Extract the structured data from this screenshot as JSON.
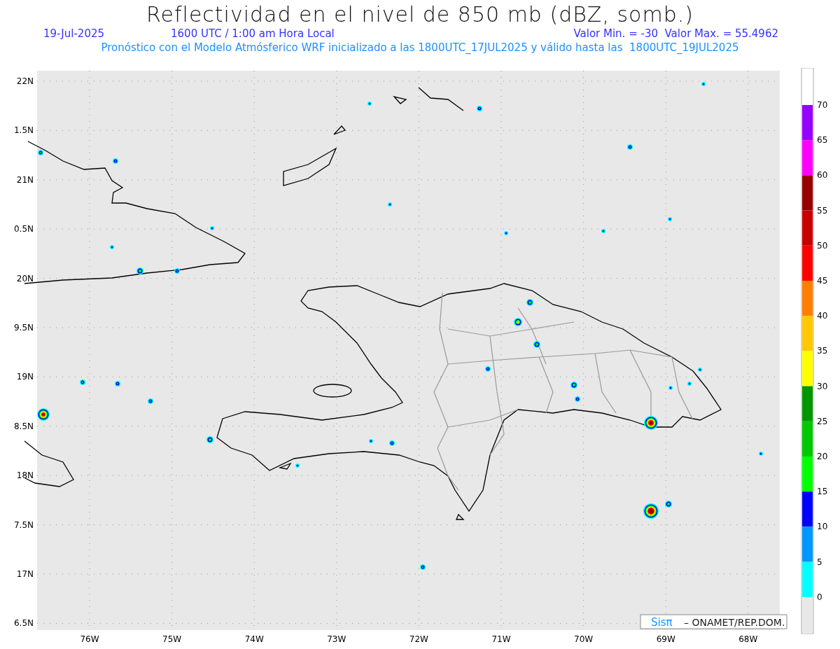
{
  "title": "Reflectividad en el nivel de 850 mb (dBZ, somb.)",
  "subtitle": {
    "date": "19-Jul-2025",
    "time": "1600 UTC / 1:00 am Hora Local",
    "range": "Valor Min. = -30  Valor Max. = 55.4962"
  },
  "description": "Pronóstico con el Modelo Atmósferico WRF inicializado a las 1800UTC_17JUL2025 y válido hasta las  1800UTC_19JUL2025",
  "map": {
    "lat_labels": [
      "22N",
      "1.5N",
      "21N",
      "0.5N",
      "20N",
      "9.5N",
      "19N",
      "8.5N",
      "18N",
      "7.5N",
      "17N",
      "6.5N"
    ],
    "lon_labels": [
      "76W",
      "75W",
      "74W",
      "73W",
      "72W",
      "71W",
      "70W",
      "69W",
      "68W"
    ]
  },
  "colorbar": {
    "labels": [
      "70",
      "65",
      "60",
      "55",
      "50",
      "45",
      "40",
      "35",
      "30",
      "25",
      "20",
      "15",
      "10",
      "5",
      "0"
    ],
    "segments": [
      {
        "color": "#ffffff"
      },
      {
        "color": "#9600ff"
      },
      {
        "color": "#ff00ff"
      },
      {
        "color": "#960000"
      },
      {
        "color": "#c80000"
      },
      {
        "color": "#ff0000"
      },
      {
        "color": "#ff7d00"
      },
      {
        "color": "#ffc800"
      },
      {
        "color": "#ffff00"
      },
      {
        "color": "#009600"
      },
      {
        "color": "#00c800"
      },
      {
        "color": "#00ff00"
      },
      {
        "color": "#0000ff"
      },
      {
        "color": "#0096ff"
      },
      {
        "color": "#00ffff"
      },
      {
        "color": "#e8e8e8"
      }
    ]
  },
  "credit": {
    "logo": "Sisπ",
    "text": "– ONAMET/REP.DOM."
  }
}
